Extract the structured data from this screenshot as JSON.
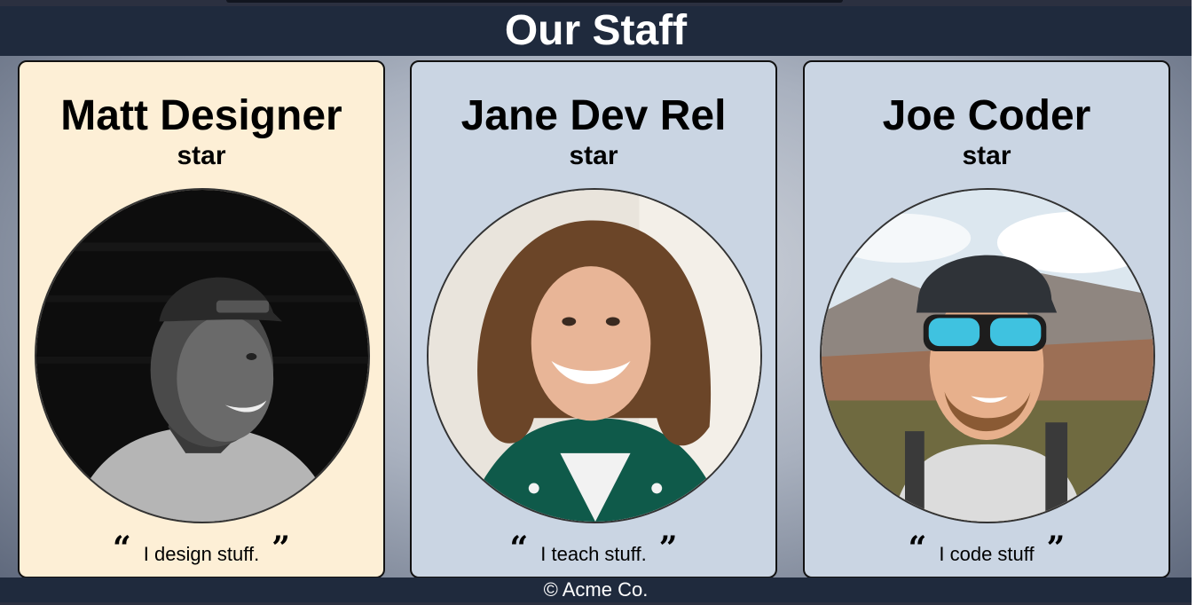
{
  "header": {
    "title": "Our Staff"
  },
  "staff": [
    {
      "name": "Matt Designer",
      "role": "star",
      "quote": "I design stuff.",
      "card_color": "#fdefd6",
      "photo_icon": "person-portrait-bw"
    },
    {
      "name": "Jane Dev Rel",
      "role": "star",
      "quote": "I teach stuff.",
      "card_color": "#cad5e3",
      "photo_icon": "person-portrait-smiling"
    },
    {
      "name": "Joe Coder",
      "role": "star",
      "quote": "I code stuff",
      "card_color": "#cad5e3",
      "photo_icon": "person-portrait-sunglasses"
    }
  ],
  "quote_marks": {
    "open": "“",
    "close": "”"
  },
  "footer": {
    "text": "© Acme Co."
  },
  "colors": {
    "header_bg": "#1f2a3d",
    "footer_bg": "#1f2a3d"
  }
}
